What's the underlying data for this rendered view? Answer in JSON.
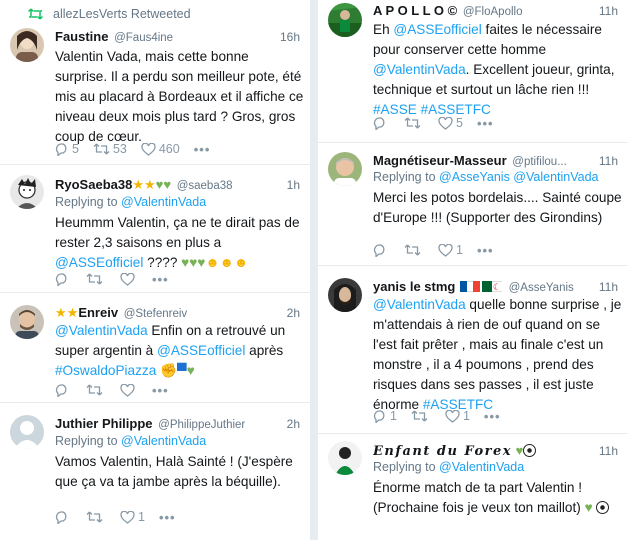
{
  "left": {
    "t1": {
      "retweet_note": "allezLesVerts Retweeted",
      "name": "Faustine",
      "handle": "@Faus4ine",
      "time": "16h",
      "text": "Valentin Vada, mais cette bonne surprise. Il a perdu son meilleur pote, été mis au placard à Bordeaux et il affiche ce niveau deux mois plus tard ? Gros, gros coup de cœur.",
      "replies": "5",
      "retweets": "53",
      "likes": "460"
    },
    "t2": {
      "name": "RyoSaeba38",
      "handle": "@saeba38",
      "time": "1h",
      "replying_prefix": "Replying to ",
      "replying_to": "@ValentinVada",
      "text_a": "Heummm Valentin, ça ne te dirait pas de rester 2,3 saisons en plus a ",
      "mention": "@ASSEofficiel",
      "text_b": " ???? ",
      "replies": "",
      "retweets": "",
      "likes": ""
    },
    "t3": {
      "name": "Enreiv",
      "handle": "@Stefenreiv",
      "time": "2h",
      "mention_a": "@ValentinVada",
      "text_a": " Enfin on a retrouvé un super argentin à ",
      "mention_b": "@ASSEofficiel",
      "text_b": " après ",
      "hashtag": "#OswaldoPiazza",
      "replies": "",
      "retweets": "",
      "likes": ""
    },
    "t4": {
      "name": "Juthier Philippe",
      "handle": "@PhilippeJuthier",
      "time": "2h",
      "replying_prefix": "Replying to ",
      "replying_to": "@ValentinVada",
      "text": "Vamos Valentin, Halà Sainté ! (J'espère que ça va ta jambe après la béquille).",
      "replies": "",
      "retweets": "",
      "likes": "1"
    }
  },
  "right": {
    "t1": {
      "name": "A P O L L O ©",
      "handle": "@FloApollo",
      "time": "11h",
      "text_a": "Eh ",
      "mention_a": "@ASSEofficiel",
      "text_b": " faites le nécessaire pour conserver cette homme ",
      "mention_b": "@ValentinVada",
      "text_c": ". Excellent joueur, grinta, technique et surtout un lâche rien !!! ",
      "hashtags": "#ASSE #ASSETFC",
      "replies": "",
      "retweets": "",
      "likes": "5"
    },
    "t2": {
      "name": "Magnétiseur-Masseur",
      "handle": "@ptifilou...",
      "time": "11h",
      "replying_prefix": "Replying to ",
      "replying_to": "@AsseYanis @ValentinVada",
      "text": "Merci les potos bordelais.... Sainté coupe d'Europe !!! (Supporter des Girondins)",
      "replies": "",
      "retweets": "",
      "likes": "1"
    },
    "t3": {
      "name": "yanis le stmg",
      "handle": "@AsseYanis",
      "time": "11h",
      "mention": "@ValentinVada",
      "text": " quelle bonne surprise , je m'attendais à rien de ouf quand on se l'est fait prêter , mais au finale c'est un monstre , il a 4 poumons , prend des risques dans  ses passes , il est juste énorme ",
      "hashtag": "#ASSETFC",
      "replies": "1",
      "retweets": "",
      "likes": "1"
    },
    "t4": {
      "name": "Enfant du Forex",
      "time": "11h",
      "replying_prefix": "Replying to ",
      "replying_to": "@ValentinVada",
      "text": "Énorme match de ta part Valentin ! (Prochaine fois je veux ton maillot) "
    }
  },
  "colors": {
    "link": "#1da1f2",
    "muted": "#657786",
    "retweet": "#17bf63",
    "heart_emoji": "#77b255"
  }
}
